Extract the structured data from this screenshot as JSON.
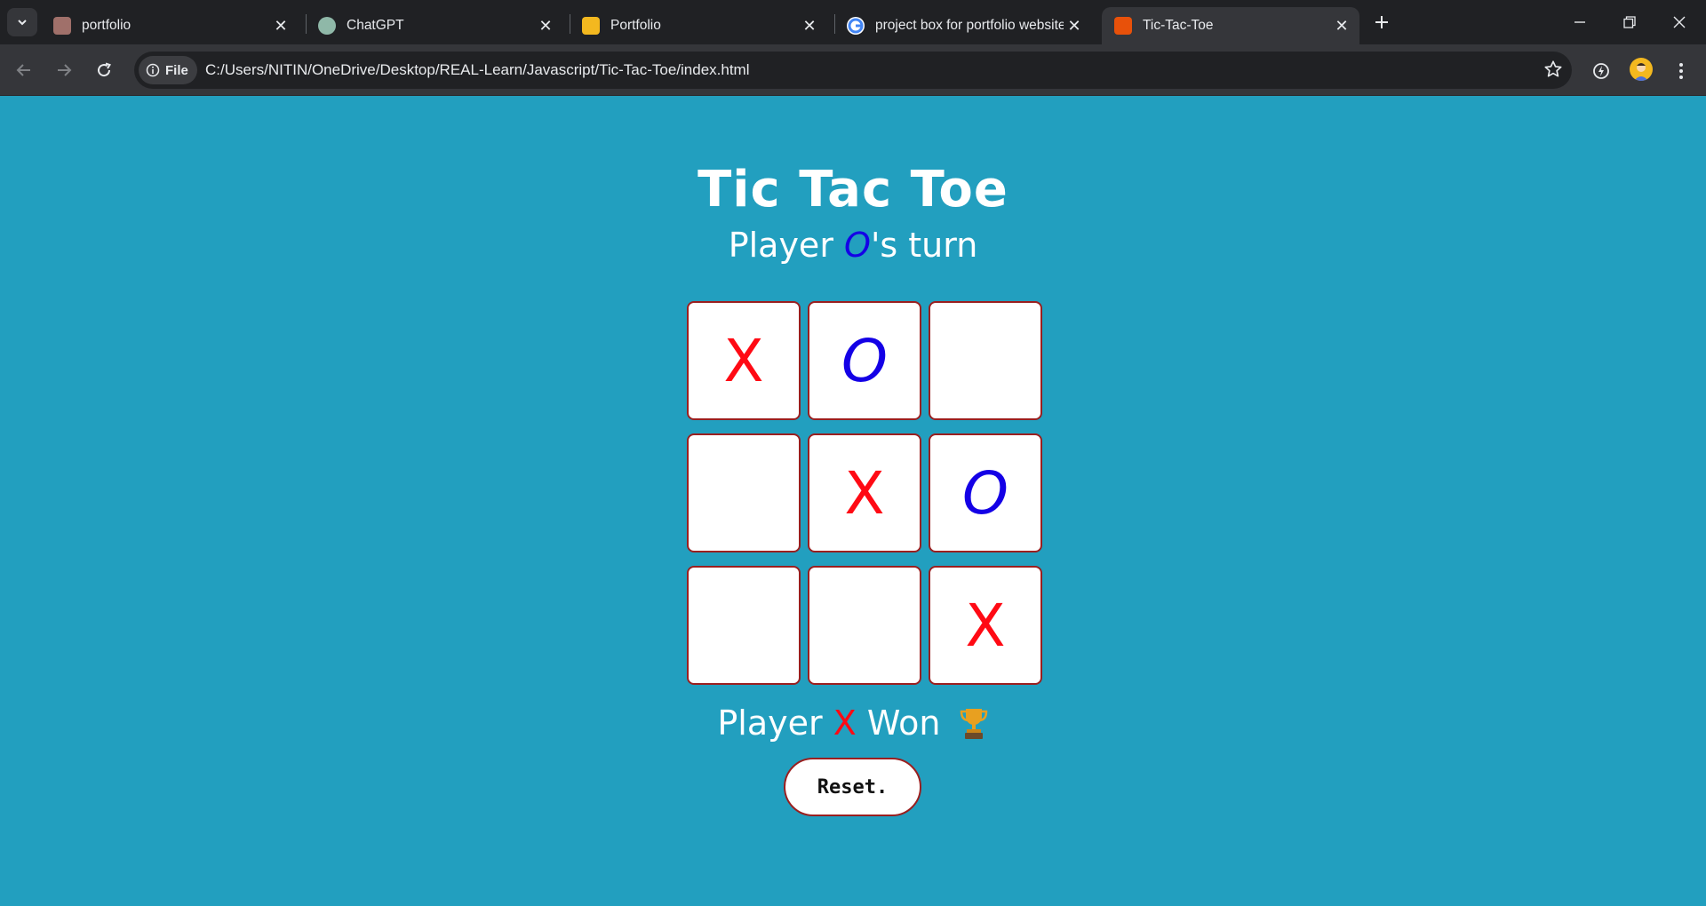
{
  "browser": {
    "tabs": [
      {
        "title": "portfolio",
        "favicon_color": "#a0706a"
      },
      {
        "title": "ChatGPT",
        "favicon_color": "#8fb8a8"
      },
      {
        "title": "Portfolio",
        "favicon_color": "#f3b81f"
      },
      {
        "title": "project box for portfolio website",
        "favicon_color": "#ffffff"
      },
      {
        "title": "Tic-Tac-Toe",
        "favicon_color": "#e8510a"
      }
    ],
    "active_tab": 4,
    "address": {
      "chip_label": "File",
      "url": "C:/Users/NITIN/OneDrive/Desktop/REAL-Learn/Javascript/Tic-Tac-Toe/index.html"
    }
  },
  "game": {
    "title": "Tic Tac Toe",
    "turn": {
      "prefix": "Player ",
      "player": "O",
      "suffix": "'s turn"
    },
    "board": [
      "X",
      "O",
      "",
      "",
      "X",
      "O",
      "",
      "",
      "X"
    ],
    "result": {
      "prefix": "Player ",
      "player": "X",
      "suffix": " Won"
    },
    "reset_label": "Reset."
  },
  "colors": {
    "background": "#229fbf",
    "x_mark": "#ff0a14",
    "o_mark": "#1400e6",
    "cell_border": "#9a1f1f"
  }
}
